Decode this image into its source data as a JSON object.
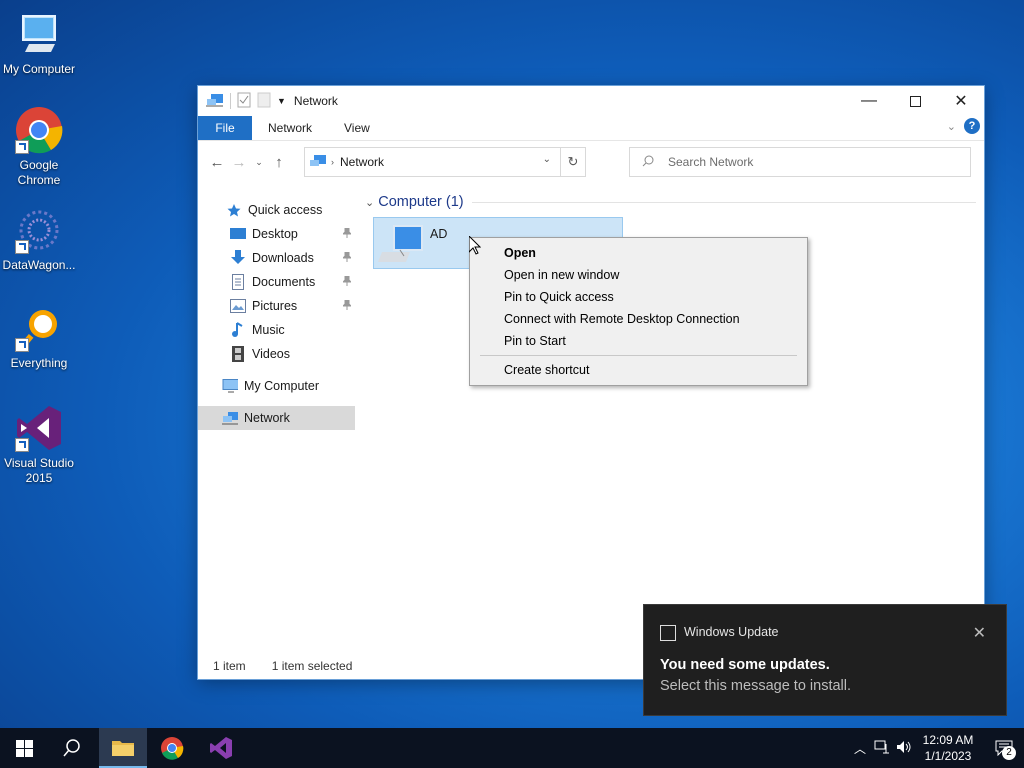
{
  "desktop": {
    "icons": [
      {
        "label": "My Computer"
      },
      {
        "label": "Google Chrome"
      },
      {
        "label": "DataWagon..."
      },
      {
        "label": "Everything"
      },
      {
        "label": "Visual Studio 2015"
      }
    ]
  },
  "window": {
    "title": "Network",
    "ribbon": {
      "file": "File",
      "tabs": [
        "Network",
        "View"
      ]
    },
    "address": {
      "path": "Network"
    },
    "search": {
      "placeholder": "Search Network"
    },
    "sidebar": {
      "quick_access": "Quick access",
      "items": [
        {
          "label": "Desktop",
          "pinned": true
        },
        {
          "label": "Downloads",
          "pinned": true
        },
        {
          "label": "Documents",
          "pinned": true
        },
        {
          "label": "Pictures",
          "pinned": true
        },
        {
          "label": "Music",
          "pinned": false
        },
        {
          "label": "Videos",
          "pinned": false
        }
      ],
      "my_computer": "My Computer",
      "network": "Network"
    },
    "content": {
      "group_header": "Computer (1)",
      "items": [
        {
          "name": "AD",
          "selected": true
        }
      ]
    },
    "status": {
      "count": "1 item",
      "selection": "1 item selected"
    }
  },
  "context_menu": {
    "items": [
      "Open",
      "Open in new window",
      "Pin to Quick access",
      "Connect with Remote Desktop Connection",
      "Pin to Start"
    ],
    "after_separator": [
      "Create shortcut"
    ]
  },
  "toast": {
    "app": "Windows Update",
    "title": "You need some updates.",
    "body": "Select this message to install."
  },
  "taskbar": {
    "time": "12:09 AM",
    "date": "1/1/2023",
    "notification_count": "2"
  },
  "colors": {
    "accent": "#1f6fc5",
    "selection": "#cce4f7",
    "toast_bg": "#1f1f1f",
    "taskbar_bg": "#0b1220"
  }
}
